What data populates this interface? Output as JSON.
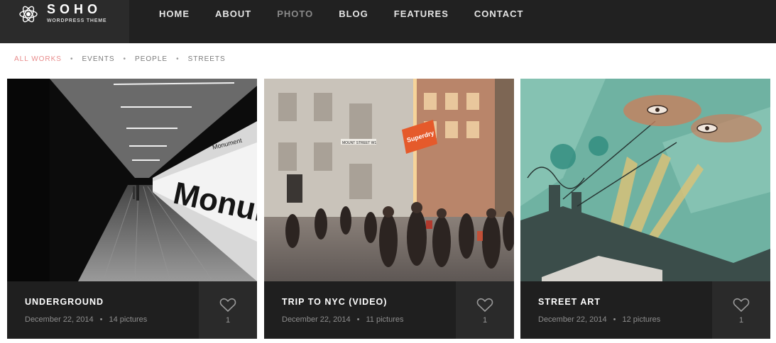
{
  "brand": {
    "title": "SOHO",
    "subtitle": "WORDPRESS THEME"
  },
  "nav": {
    "items": [
      {
        "label": "HOME",
        "active": false
      },
      {
        "label": "ABOUT",
        "active": false
      },
      {
        "label": "PHOTO",
        "active": true
      },
      {
        "label": "BLOG",
        "active": false
      },
      {
        "label": "FEATURES",
        "active": false
      },
      {
        "label": "CONTACT",
        "active": false
      }
    ]
  },
  "filters": {
    "separator": "•",
    "items": [
      {
        "label": "ALL WORKS",
        "active": true
      },
      {
        "label": "EVENTS",
        "active": false
      },
      {
        "label": "PEOPLE",
        "active": false
      },
      {
        "label": "STREETS",
        "active": false
      }
    ]
  },
  "cards": [
    {
      "title": "UNDERGROUND",
      "date": "December 22, 2014",
      "separator": "•",
      "pictures": "14 pictures",
      "likes": "1",
      "image_text": "Monumer",
      "sign_text": "Monument"
    },
    {
      "title": "TRIP TO NYC (VIDEO)",
      "date": "December 22, 2014",
      "separator": "•",
      "pictures": "11 pictures",
      "likes": "1",
      "image_text": "Superdry",
      "sign_text": "MOUNT STREET W1"
    },
    {
      "title": "STREET ART",
      "date": "December 22, 2014",
      "separator": "•",
      "pictures": "12 pictures",
      "likes": "1"
    }
  ],
  "colors": {
    "header_bg": "#212121",
    "logo_bg": "#2b2b2b",
    "accent": "#e88c8c",
    "card_bg": "#1f1f1f",
    "like_bg": "#2a2a2a"
  }
}
